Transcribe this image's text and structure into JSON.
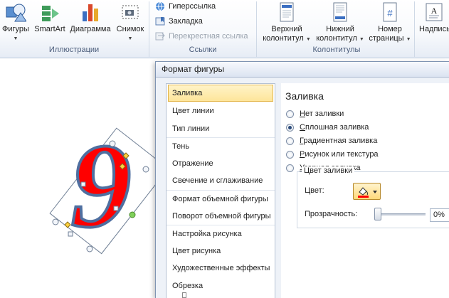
{
  "ribbon": {
    "illustrations": {
      "buttons": [
        {
          "label": "Фигуры",
          "icon": "shapes-icon"
        },
        {
          "label": "SmartArt",
          "icon": "smartart-icon"
        },
        {
          "label": "Диаграмма",
          "icon": "chart-icon"
        },
        {
          "label": "Снимок",
          "icon": "screenshot-icon"
        }
      ],
      "group_label": "Иллюстрации"
    },
    "links": {
      "items": [
        {
          "label": "Гиперссылка",
          "icon": "hyperlink-icon"
        },
        {
          "label": "Закладка",
          "icon": "bookmark-icon"
        },
        {
          "label": "Перекрестная ссылка",
          "icon": "cross-reference-icon",
          "disabled": true
        }
      ],
      "group_label": "Ссылки"
    },
    "header_footer": {
      "buttons": [
        {
          "line1": "Верхний",
          "line2": "колонтитул",
          "icon": "header-icon"
        },
        {
          "line1": "Нижний",
          "line2": "колонтитул",
          "icon": "footer-icon"
        },
        {
          "line1": "Номер",
          "line2": "страницы",
          "icon": "page-number-icon"
        }
      ],
      "group_label": "Колонтитулы"
    },
    "text": {
      "buttons": [
        {
          "label": "Надпись",
          "icon": "textbox-icon"
        }
      ]
    }
  },
  "dialog": {
    "title": "Формат фигуры",
    "categories": [
      "Заливка",
      "Цвет линии",
      "Тип линии",
      "Тень",
      "Отражение",
      "Свечение и сглаживание",
      "Формат объемной фигуры",
      "Поворот объемной фигуры",
      "Настройка рисунка",
      "Цвет рисунка",
      "Художественные эффекты",
      "Обрезка"
    ],
    "selected_category": "Заливка",
    "panel": {
      "title": "Заливка",
      "options": [
        {
          "pre": "",
          "u": "Н",
          "post": "ет заливки",
          "checked": false
        },
        {
          "pre": "",
          "u": "С",
          "post": "плошная заливка",
          "checked": true
        },
        {
          "pre": "",
          "u": "Г",
          "post": "радиентная заливка",
          "checked": false
        },
        {
          "pre": "",
          "u": "Р",
          "post": "исунок или текстура",
          "checked": false
        },
        {
          "pre": "",
          "u": "У",
          "post": "зорная заливка",
          "checked": false
        }
      ],
      "fill_color_group": "Цвет заливки",
      "color_label": "Цвет:",
      "color_value": "#ff0000",
      "transparency_label": "Прозрачность:",
      "transparency_value": "0%"
    }
  },
  "document": {
    "shape_glyph": "9",
    "shape_fill": "#ff0000",
    "shape_outline": "#4f6fa0"
  }
}
